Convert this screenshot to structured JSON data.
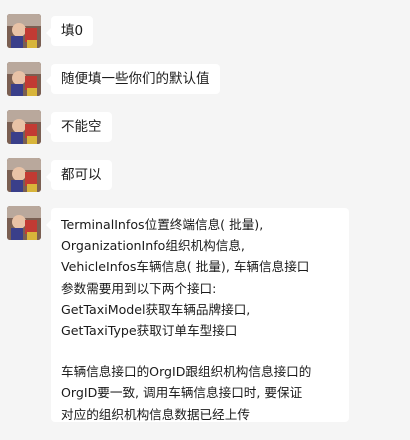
{
  "messages": [
    {
      "text": "填0"
    },
    {
      "text": "随便填一些你们的默认值"
    },
    {
      "text": "不能空"
    },
    {
      "text": "都可以"
    },
    {
      "lines": [
        "TerminalInfos位置终端信息( 批量),",
        "OrganizationInfo组织机构信息,",
        "VehicleInfos车辆信息( 批量), 车辆信息接口",
        "参数需要用到以下两个接口:",
        "GetTaxiModel获取车辆品牌接口,",
        "GetTaxiType获取订单车型接口"
      ],
      "lines2": [
        "车辆信息接口的OrgID跟组织机构信息接口的",
        "OrgID要一致, 调用车辆信息接口时, 要保证",
        "对应的组织机构信息数据已经上传"
      ]
    }
  ]
}
